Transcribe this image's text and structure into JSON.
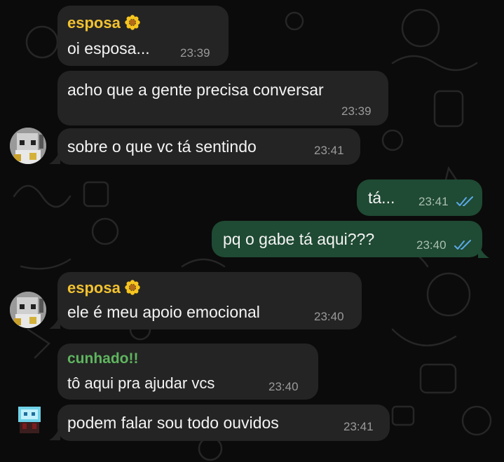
{
  "colors": {
    "esposa_name": "#f2c230",
    "cunhado_name": "#5fb55f",
    "incoming_bubble": "#242424",
    "outgoing_bubble": "#1f4a33",
    "read_ticks": "#5aa8e6"
  },
  "messages": [
    {
      "sender": "esposa",
      "text": "oi esposa...",
      "time": "23:39"
    },
    {
      "text": "acho que a gente precisa conversar",
      "time": "23:39"
    },
    {
      "text": "sobre o que vc tá sentindo",
      "time": "23:41"
    },
    {
      "text": "tá...",
      "time": "23:41",
      "status": "read"
    },
    {
      "text": "pq o gabe tá aqui???",
      "time": "23:40",
      "status": "read"
    },
    {
      "sender": "esposa",
      "text": "ele é meu apoio emocional",
      "time": "23:40"
    },
    {
      "sender": "cunhado!!",
      "text": "tô aqui pra ajudar vcs",
      "time": "23:40"
    },
    {
      "text": "podem falar sou todo ouvidos",
      "time": "23:41"
    }
  ],
  "icons": {
    "sender_emoji": "sunflower-icon",
    "status": "double-check-icon"
  }
}
